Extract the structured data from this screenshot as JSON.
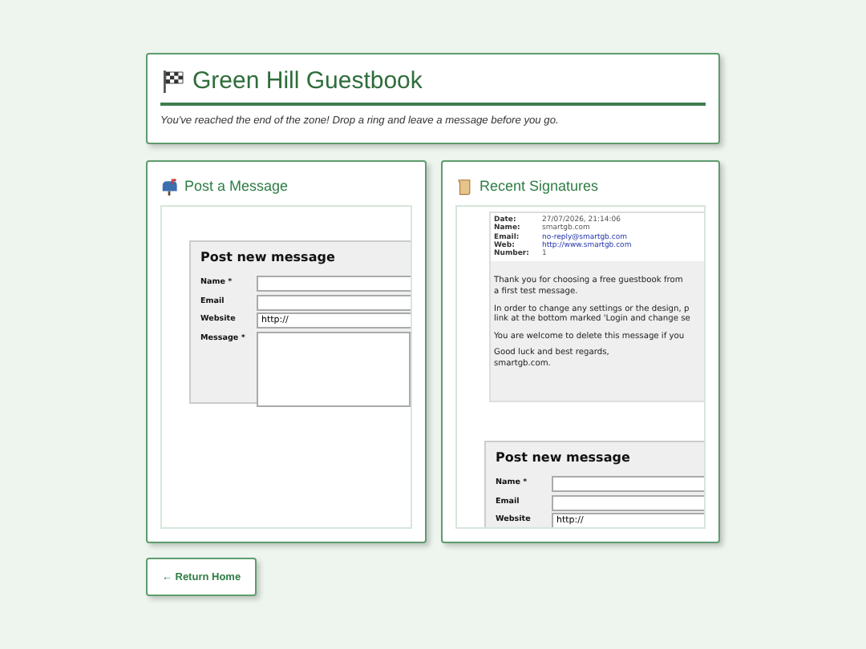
{
  "header": {
    "title": "Green Hill Guestbook",
    "subtitle": "You've reached the end of the zone! Drop a ring and leave a message before you go."
  },
  "post_panel": {
    "title": "Post a Message",
    "form": {
      "heading": "Post new message",
      "fields": [
        {
          "kind": "text",
          "label": "Name *"
        },
        {
          "kind": "text",
          "label": "Email"
        },
        {
          "kind": "text",
          "label": "Website",
          "value": "http://"
        },
        {
          "kind": "textarea",
          "label": "Message *"
        }
      ]
    }
  },
  "signatures_panel": {
    "title": "Recent Signatures",
    "entry": {
      "meta": [
        {
          "label": "Date:",
          "value": "27/07/2026, 21:14:06",
          "link": false
        },
        {
          "label": "Name:",
          "value": "smartgb.com",
          "link": false
        },
        {
          "label": "Email:",
          "value": "no-reply@smartgb.com",
          "link": true
        },
        {
          "label": "Web:",
          "value": "http://www.smartgb.com",
          "link": true
        },
        {
          "label": "Number:",
          "value": "1",
          "link": false
        }
      ],
      "paragraphs": [
        [
          "Thank you for choosing a free guestbook from",
          "a first test message."
        ],
        [
          "In order to change any settings or the design, p",
          "link at the bottom marked 'Login and change se"
        ],
        [
          "You are welcome to delete this message if you"
        ],
        [
          "Good luck and best regards,",
          "smartgb.com."
        ]
      ]
    },
    "form": {
      "heading": "Post new message",
      "fields": [
        {
          "kind": "text",
          "label": "Name *"
        },
        {
          "kind": "text",
          "label": "Email"
        },
        {
          "kind": "text",
          "label": "Website",
          "value": "http://"
        }
      ]
    }
  },
  "back_button": "← Return Home"
}
